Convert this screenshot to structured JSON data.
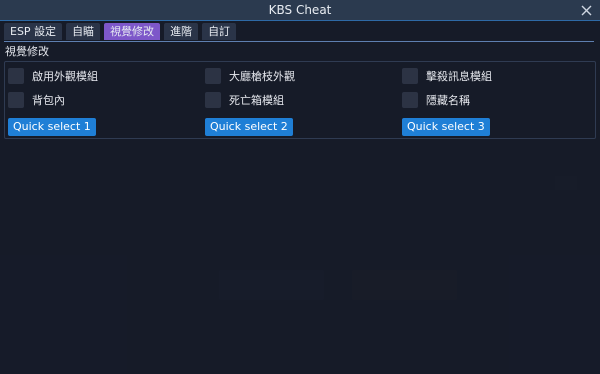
{
  "window": {
    "title": "KBS Cheat"
  },
  "tabs": [
    {
      "label": "ESP 設定"
    },
    {
      "label": "自瞄"
    },
    {
      "label": "視覺修改"
    },
    {
      "label": "進階"
    },
    {
      "label": "自訂"
    }
  ],
  "active_tab": "視覺修改",
  "section": {
    "title": "視覺修改"
  },
  "options": [
    {
      "label": "啟用外觀模組",
      "checked": false
    },
    {
      "label": "大廳槍枝外觀",
      "checked": false
    },
    {
      "label": "擊殺訊息模組",
      "checked": false
    },
    {
      "label": "背包內",
      "checked": false
    },
    {
      "label": "死亡箱模組",
      "checked": false
    },
    {
      "label": "隱藏名稱",
      "checked": false
    }
  ],
  "quick_select": [
    {
      "label": "Quick select 1"
    },
    {
      "label": "Quick select 2"
    },
    {
      "label": "Quick select 3"
    }
  ],
  "colors": {
    "accent_tab": "#7d57c9",
    "quick_select_button": "#1f7fd6",
    "titlebar": "#2b3a4f"
  },
  "icons": {
    "close": "close-icon"
  }
}
